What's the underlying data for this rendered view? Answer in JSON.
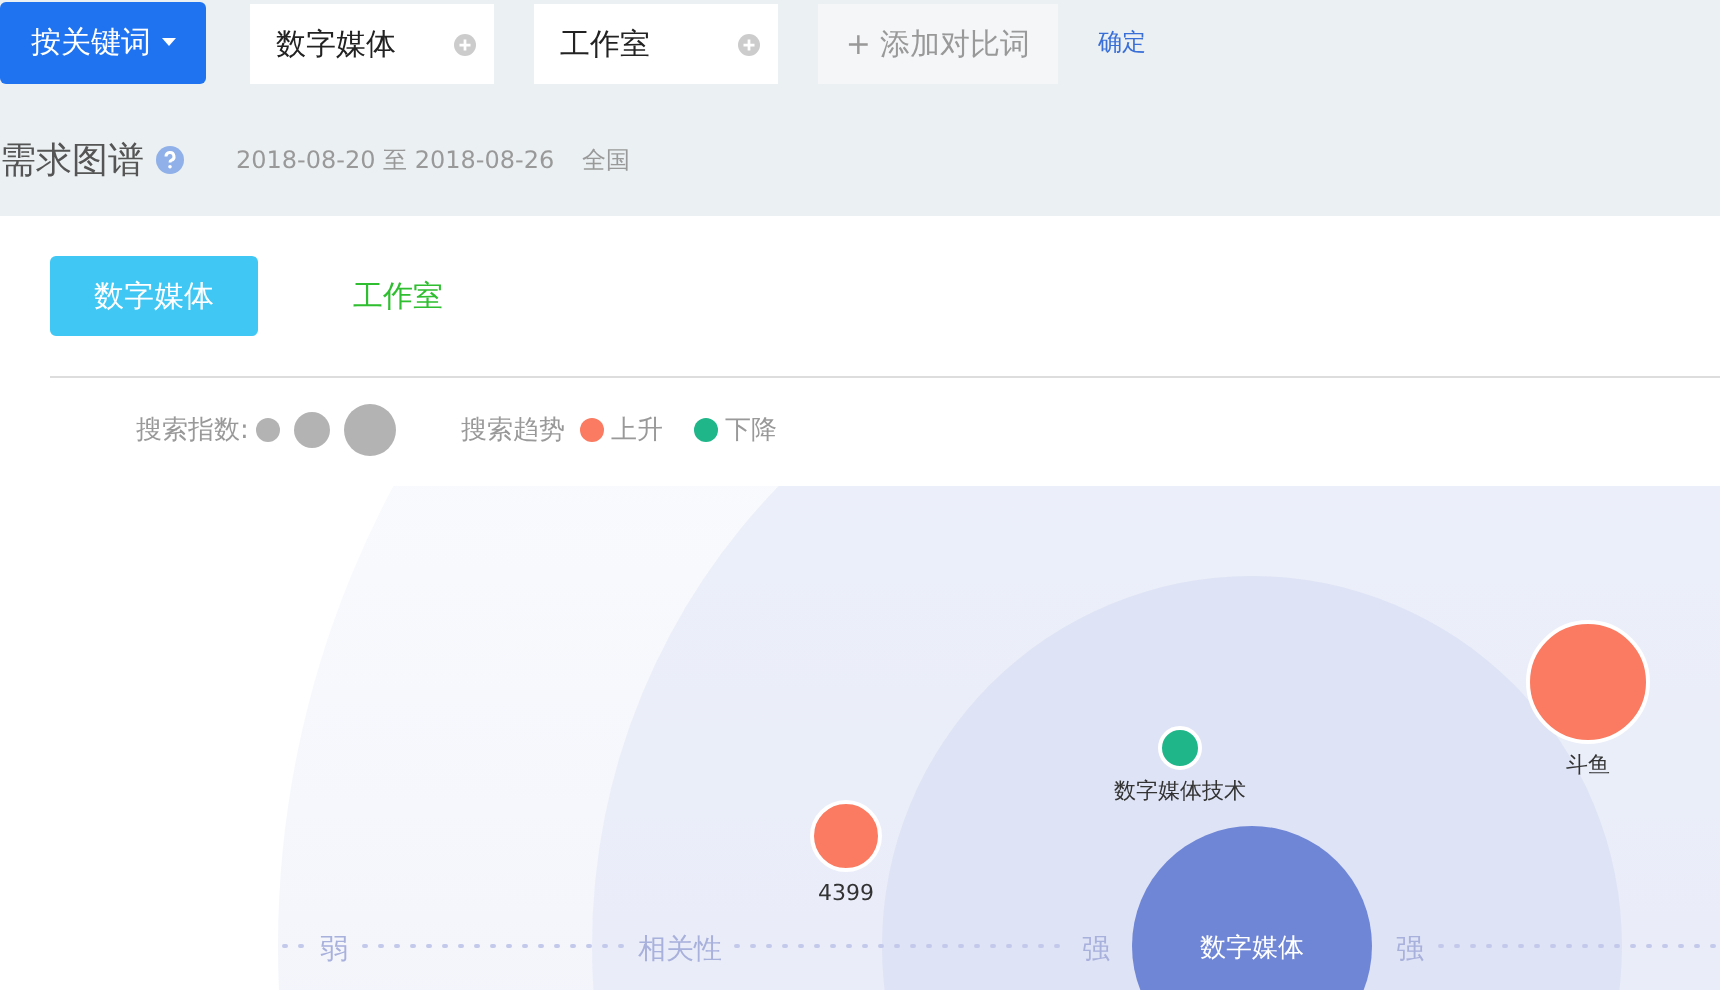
{
  "toolbar": {
    "mode_button": "按关键词",
    "keywords": [
      {
        "value": "数字媒体"
      },
      {
        "value": "工作室"
      }
    ],
    "add_button": "+ 添加对比词",
    "confirm_link": "确定"
  },
  "header": {
    "title": "需求图谱",
    "date_range": "2018-08-20 至 2018-08-26",
    "region": "全国"
  },
  "tabs": [
    {
      "label": "数字媒体",
      "selected": true
    },
    {
      "label": "工作室",
      "selected": false
    }
  ],
  "legend": {
    "size_label": "搜索指数:",
    "trend_label": "搜索趋势",
    "trends": [
      {
        "label": "上升",
        "color": "#fa7b61"
      },
      {
        "label": "下降",
        "color": "#1fb68a"
      }
    ]
  },
  "graph": {
    "axis_labels": [
      "弱",
      "相关性",
      "强",
      "强"
    ],
    "center": {
      "label": "数字媒体"
    },
    "nodes": [
      {
        "label": "4399",
        "color": "#fa7b61"
      },
      {
        "label": "数字媒体技术",
        "color": "#1fb68a"
      },
      {
        "label": "斗鱼",
        "color": "#fa7b61"
      }
    ]
  }
}
